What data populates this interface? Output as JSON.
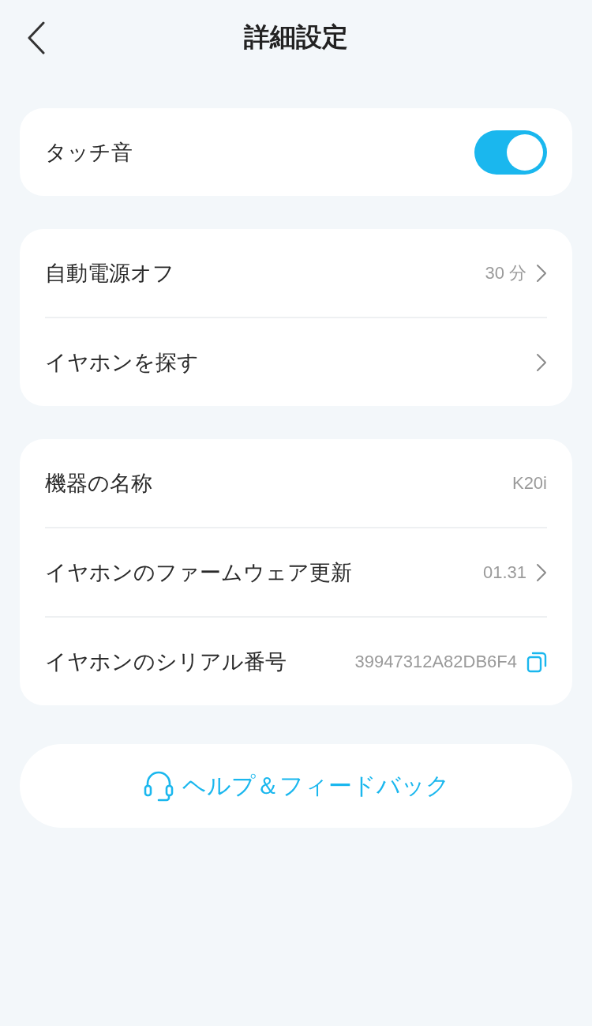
{
  "header": {
    "title": "詳細設定"
  },
  "groups": [
    {
      "rows": [
        {
          "kind": "toggle",
          "label": "タッチ音",
          "on": true
        }
      ]
    },
    {
      "rows": [
        {
          "kind": "link",
          "label": "自動電源オフ",
          "value": "30 分"
        },
        {
          "kind": "link",
          "label": "イヤホンを探す"
        }
      ]
    },
    {
      "rows": [
        {
          "kind": "value",
          "label": "機器の名称",
          "value": "K20i"
        },
        {
          "kind": "link",
          "label": "イヤホンのファームウェア更新",
          "value": "01.31"
        },
        {
          "kind": "copy",
          "label": "イヤホンのシリアル番号",
          "value": "39947312A82DB6F4"
        }
      ]
    }
  ],
  "help_button": {
    "label": "ヘルプ＆フィードバック"
  }
}
